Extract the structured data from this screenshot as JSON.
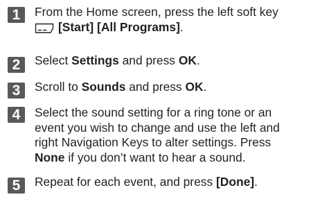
{
  "steps": [
    {
      "number": "1",
      "lines": [
        [
          {
            "t": "From the Home screen, press the left soft key"
          }
        ],
        [
          {
            "icon": "softkey-icon"
          },
          {
            "t": "[Start] [All Programs]",
            "b": true
          },
          {
            "t": "."
          }
        ]
      ]
    },
    {
      "number": "2",
      "lines": [
        [
          {
            "t": "Select "
          },
          {
            "t": "Settings",
            "b": true
          },
          {
            "t": " and press "
          },
          {
            "t": "OK",
            "b": true
          },
          {
            "t": "."
          }
        ]
      ]
    },
    {
      "number": "3",
      "lines": [
        [
          {
            "t": "Scroll to "
          },
          {
            "t": "Sounds",
            "b": true
          },
          {
            "t": " and press "
          },
          {
            "t": "OK",
            "b": true
          },
          {
            "t": "."
          }
        ]
      ]
    },
    {
      "number": "4",
      "lines": [
        [
          {
            "t": "Select the sound setting for a ring tone or an"
          }
        ],
        [
          {
            "t": "event you wish to change and use the left and"
          }
        ],
        [
          {
            "t": "right Navigation Keys to alter settings. Press"
          }
        ],
        [
          {
            "t": "None",
            "b": true
          },
          {
            "t": " if you don’t want to hear a sound."
          }
        ]
      ]
    },
    {
      "number": "5",
      "lines": [
        [
          {
            "t": "Repeat for each event, and press "
          },
          {
            "t": "[Done]",
            "b": true
          },
          {
            "t": "."
          }
        ]
      ]
    }
  ],
  "colors": {
    "badge": "#58595b",
    "text": "#231f20"
  }
}
